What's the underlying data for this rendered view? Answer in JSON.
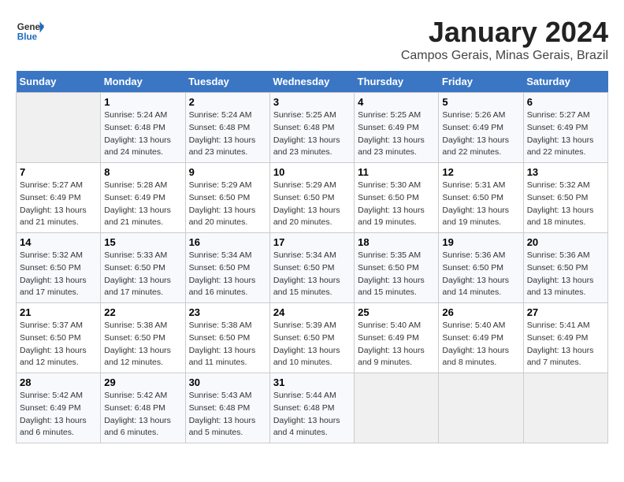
{
  "header": {
    "logo_general": "General",
    "logo_blue": "Blue",
    "title": "January 2024",
    "subtitle": "Campos Gerais, Minas Gerais, Brazil"
  },
  "calendar": {
    "days_of_week": [
      "Sunday",
      "Monday",
      "Tuesday",
      "Wednesday",
      "Thursday",
      "Friday",
      "Saturday"
    ],
    "weeks": [
      [
        {
          "day": "",
          "detail": ""
        },
        {
          "day": "1",
          "detail": "Sunrise: 5:24 AM\nSunset: 6:48 PM\nDaylight: 13 hours\nand 24 minutes."
        },
        {
          "day": "2",
          "detail": "Sunrise: 5:24 AM\nSunset: 6:48 PM\nDaylight: 13 hours\nand 23 minutes."
        },
        {
          "day": "3",
          "detail": "Sunrise: 5:25 AM\nSunset: 6:48 PM\nDaylight: 13 hours\nand 23 minutes."
        },
        {
          "day": "4",
          "detail": "Sunrise: 5:25 AM\nSunset: 6:49 PM\nDaylight: 13 hours\nand 23 minutes."
        },
        {
          "day": "5",
          "detail": "Sunrise: 5:26 AM\nSunset: 6:49 PM\nDaylight: 13 hours\nand 22 minutes."
        },
        {
          "day": "6",
          "detail": "Sunrise: 5:27 AM\nSunset: 6:49 PM\nDaylight: 13 hours\nand 22 minutes."
        }
      ],
      [
        {
          "day": "7",
          "detail": "Sunrise: 5:27 AM\nSunset: 6:49 PM\nDaylight: 13 hours\nand 21 minutes."
        },
        {
          "day": "8",
          "detail": "Sunrise: 5:28 AM\nSunset: 6:49 PM\nDaylight: 13 hours\nand 21 minutes."
        },
        {
          "day": "9",
          "detail": "Sunrise: 5:29 AM\nSunset: 6:50 PM\nDaylight: 13 hours\nand 20 minutes."
        },
        {
          "day": "10",
          "detail": "Sunrise: 5:29 AM\nSunset: 6:50 PM\nDaylight: 13 hours\nand 20 minutes."
        },
        {
          "day": "11",
          "detail": "Sunrise: 5:30 AM\nSunset: 6:50 PM\nDaylight: 13 hours\nand 19 minutes."
        },
        {
          "day": "12",
          "detail": "Sunrise: 5:31 AM\nSunset: 6:50 PM\nDaylight: 13 hours\nand 19 minutes."
        },
        {
          "day": "13",
          "detail": "Sunrise: 5:32 AM\nSunset: 6:50 PM\nDaylight: 13 hours\nand 18 minutes."
        }
      ],
      [
        {
          "day": "14",
          "detail": "Sunrise: 5:32 AM\nSunset: 6:50 PM\nDaylight: 13 hours\nand 17 minutes."
        },
        {
          "day": "15",
          "detail": "Sunrise: 5:33 AM\nSunset: 6:50 PM\nDaylight: 13 hours\nand 17 minutes."
        },
        {
          "day": "16",
          "detail": "Sunrise: 5:34 AM\nSunset: 6:50 PM\nDaylight: 13 hours\nand 16 minutes."
        },
        {
          "day": "17",
          "detail": "Sunrise: 5:34 AM\nSunset: 6:50 PM\nDaylight: 13 hours\nand 15 minutes."
        },
        {
          "day": "18",
          "detail": "Sunrise: 5:35 AM\nSunset: 6:50 PM\nDaylight: 13 hours\nand 15 minutes."
        },
        {
          "day": "19",
          "detail": "Sunrise: 5:36 AM\nSunset: 6:50 PM\nDaylight: 13 hours\nand 14 minutes."
        },
        {
          "day": "20",
          "detail": "Sunrise: 5:36 AM\nSunset: 6:50 PM\nDaylight: 13 hours\nand 13 minutes."
        }
      ],
      [
        {
          "day": "21",
          "detail": "Sunrise: 5:37 AM\nSunset: 6:50 PM\nDaylight: 13 hours\nand 12 minutes."
        },
        {
          "day": "22",
          "detail": "Sunrise: 5:38 AM\nSunset: 6:50 PM\nDaylight: 13 hours\nand 12 minutes."
        },
        {
          "day": "23",
          "detail": "Sunrise: 5:38 AM\nSunset: 6:50 PM\nDaylight: 13 hours\nand 11 minutes."
        },
        {
          "day": "24",
          "detail": "Sunrise: 5:39 AM\nSunset: 6:50 PM\nDaylight: 13 hours\nand 10 minutes."
        },
        {
          "day": "25",
          "detail": "Sunrise: 5:40 AM\nSunset: 6:49 PM\nDaylight: 13 hours\nand 9 minutes."
        },
        {
          "day": "26",
          "detail": "Sunrise: 5:40 AM\nSunset: 6:49 PM\nDaylight: 13 hours\nand 8 minutes."
        },
        {
          "day": "27",
          "detail": "Sunrise: 5:41 AM\nSunset: 6:49 PM\nDaylight: 13 hours\nand 7 minutes."
        }
      ],
      [
        {
          "day": "28",
          "detail": "Sunrise: 5:42 AM\nSunset: 6:49 PM\nDaylight: 13 hours\nand 6 minutes."
        },
        {
          "day": "29",
          "detail": "Sunrise: 5:42 AM\nSunset: 6:48 PM\nDaylight: 13 hours\nand 6 minutes."
        },
        {
          "day": "30",
          "detail": "Sunrise: 5:43 AM\nSunset: 6:48 PM\nDaylight: 13 hours\nand 5 minutes."
        },
        {
          "day": "31",
          "detail": "Sunrise: 5:44 AM\nSunset: 6:48 PM\nDaylight: 13 hours\nand 4 minutes."
        },
        {
          "day": "",
          "detail": ""
        },
        {
          "day": "",
          "detail": ""
        },
        {
          "day": "",
          "detail": ""
        }
      ]
    ]
  }
}
